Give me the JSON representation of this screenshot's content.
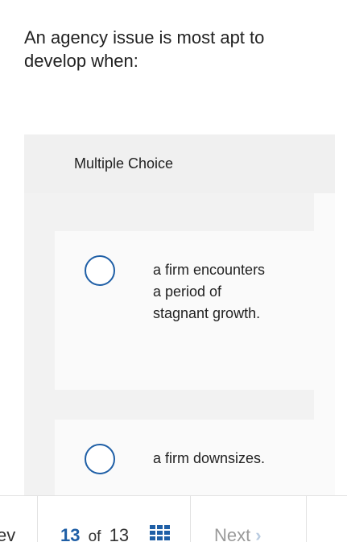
{
  "question": {
    "text": "An agency issue is most apt to develop when:"
  },
  "card": {
    "header": "Multiple Choice",
    "options": [
      {
        "label": "a firm encounters a period of stagnant growth.",
        "selected": false
      },
      {
        "label": "a firm downsizes.",
        "selected": false
      }
    ]
  },
  "footer": {
    "prev_label": "Prev",
    "current_page": "13",
    "of_label": "of",
    "total_pages": "13",
    "next_label": "Next",
    "grid_icon": "grid-icon",
    "chevron_icon": "chevron-right-icon",
    "accent_color": "#1f5fa6"
  }
}
